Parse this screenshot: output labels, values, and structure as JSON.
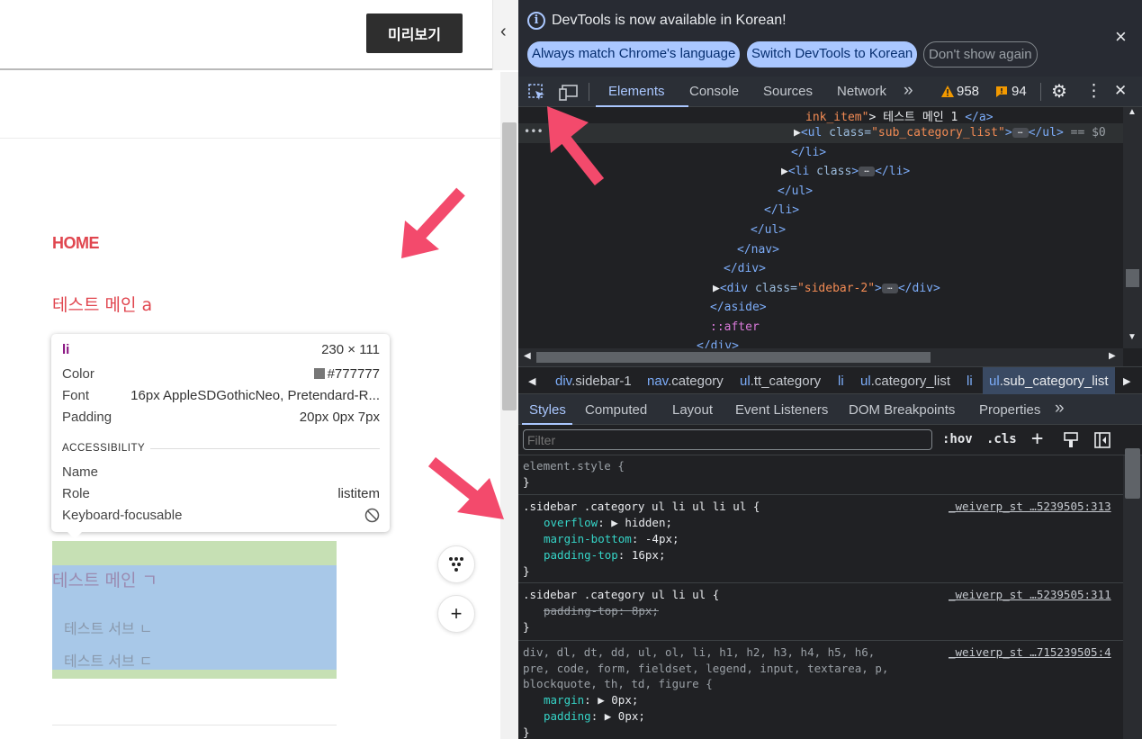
{
  "page": {
    "preview_button": "미리보기",
    "collapse_chevron": "‹",
    "categories": {
      "home": "HOME",
      "main_a": "테스트 메인 a",
      "main_g": "테스트 메인 ㄱ",
      "sub_items": [
        "테스트 서브 ㄴ",
        "테스트 서브 ㄷ"
      ]
    },
    "tooltip": {
      "tag": "li",
      "size": "230 × 111",
      "color_label": "Color",
      "color_value": "#777777",
      "font_label": "Font",
      "font_value": "16px AppleSDGothicNeo, Pretendard-R...",
      "padding_label": "Padding",
      "padding_value": "20px 0px 7px",
      "accessibility_heading": "ACCESSIBILITY",
      "name_label": "Name",
      "role_label": "Role",
      "role_value": "listitem",
      "focus_label": "Keyboard-focusable",
      "focus_icon": "⃠"
    },
    "swatch_color": "#777777",
    "highlight_colors": {
      "margin": "#c6e0b4",
      "content": "#a8c8e8"
    },
    "buttons": {
      "tree": "⋮",
      "plus": "+"
    }
  },
  "devtools": {
    "infobar": {
      "icon": "i",
      "text": "DevTools is now available in Korean!",
      "btn_match": "Always match Chrome's language",
      "btn_switch": "Switch DevTools to Korean",
      "btn_dont": "Don't show again",
      "close": "×"
    },
    "toolbar": {
      "tabs": [
        "Elements",
        "Console",
        "Sources",
        "Network"
      ],
      "more": "»",
      "warnings": "958",
      "issues": "94",
      "gear": "⚙",
      "kebab": "⋮",
      "close": "✕"
    },
    "dom": {
      "gutter_dots": "•••",
      "lines": [
        {
          "t": "ink_item\"> 테스트 메인 1 </a>"
        },
        {
          "t": "<ul class=\"sub_category_list\">…</ul> == $0"
        },
        {
          "t": "</li>"
        },
        {
          "t": "<li class>…</li>"
        },
        {
          "t": "</ul>"
        },
        {
          "t": "</li>"
        },
        {
          "t": "</ul>"
        },
        {
          "t": "</nav>"
        },
        {
          "t": "</div>"
        },
        {
          "t": "<div class=\"sidebar-2\">…</div>"
        },
        {
          "t": "</aside>"
        },
        {
          "t": "::after"
        },
        {
          "t": "</div>"
        }
      ],
      "parts": {
        "l0_aval": "ink_item\"",
        "l0_txt": "> 테스트 메인 1 ",
        "l0_close": "</a>",
        "ul_open": "<ul",
        "class_attr": " class=",
        "sub_cat_val": "\"sub_category_list\"",
        "gt": ">",
        "ul_close": "</ul>",
        "dollar": " == $0",
        "li_close": "</li>",
        "li_open": "<li",
        "li_class": " class",
        "li_end": "</li>",
        "ul_end": "</ul>",
        "li_end2": "</li>",
        "ul_end2": "</ul>",
        "nav_end": "</nav>",
        "div_end": "</div>",
        "div_open": "<div",
        "sidebar2_val": "\"sidebar-2\"",
        "div_close": "</div>",
        "aside_end": "</aside>",
        "after": "::after",
        "div_end2": "</div>",
        "ellipsis": "…"
      }
    },
    "breadcrumbs": [
      {
        "a": "div",
        "b": ".sidebar-1"
      },
      {
        "a": "nav",
        "b": ".category"
      },
      {
        "a": "ul",
        "b": ".tt_category"
      },
      {
        "a": "li",
        "b": ""
      },
      {
        "a": "ul",
        "b": ".category_list"
      },
      {
        "a": "li",
        "b": ""
      },
      {
        "a": "ul",
        "b": ".sub_category_list"
      }
    ],
    "styles_tabs": [
      "Styles",
      "Computed",
      "Layout",
      "Event Listeners",
      "DOM Breakpoints",
      "Properties"
    ],
    "styles_more": "»",
    "filter": {
      "placeholder": "Filter",
      "hov": ":hov",
      "cls": ".cls",
      "plus": "+",
      "paint": "🖌",
      "toggle": "◧"
    },
    "rules": {
      "element_style": "element.style {",
      "close_brace": "}",
      "r1_selector": ".sidebar .category ul li ul li ul {",
      "r1_source": "_weiverp_st …5239505:313",
      "r1_p1": "overflow",
      "r1_v1": "▶ hidden;",
      "r1_p2": "margin-bottom",
      "r1_v2": "-4px;",
      "r1_p3": "padding-top",
      "r1_v3": "16px;",
      "r2_selector": ".sidebar .category ul li ul {",
      "r2_source": "_weiverp_st …5239505:311",
      "r2_struck": "padding-top: 8px;",
      "r3_selector_l1": "div, dl, dt, dd, ul, ol, li, h1, h2, h3, h4, h5, h6,",
      "r3_selector_l2": "pre, code, form, fieldset, legend, input, textarea, p,",
      "r3_selector_l3": "blockquote, th, td, figure {",
      "r3_source": "_weiverp_st …715239505:4",
      "r3_p1": "margin",
      "r3_v1": "▶ 0px;",
      "r3_p2": "padding",
      "r3_v2": "▶ 0px;"
    }
  },
  "colors": {
    "accent": "#aac7ff",
    "arrow": "#f34a6c",
    "brand_red": "#e0464f"
  }
}
